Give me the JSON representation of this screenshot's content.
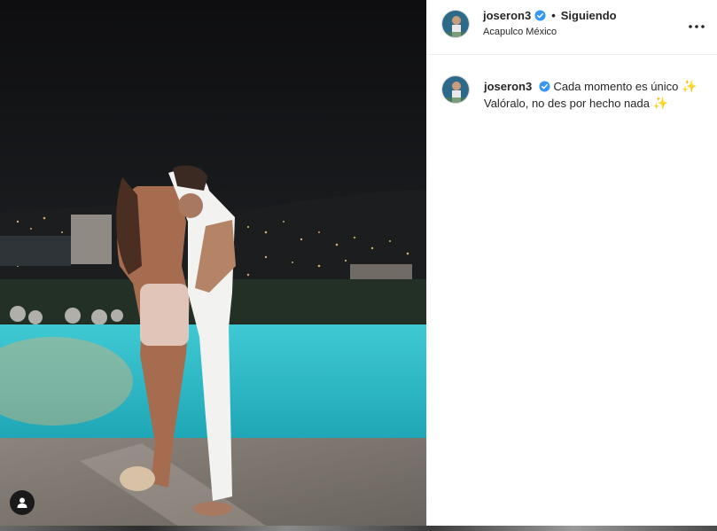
{
  "post": {
    "username": "joseron3",
    "separator": "•",
    "follow_status": "Siguiendo",
    "location": "Acapulco México",
    "caption": {
      "username": "joseron3",
      "line1": "Cada momento es único",
      "line2": "Valóralo, no des por hecho nada",
      "emoji": "✨"
    }
  },
  "icons": {
    "verified": "verified-badge-icon",
    "more": "more-options-icon",
    "user_tag": "user-tag-icon"
  },
  "colors": {
    "verified": "#3897f0",
    "text": "#262626",
    "border": "#efefef"
  }
}
